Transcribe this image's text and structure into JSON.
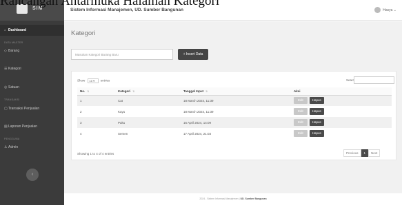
{
  "caption": "Rancangan Antarmuka Halaman Kategori",
  "sidebar": {
    "logo_text": "SIM",
    "items": [
      {
        "label": "Dashboard",
        "icon": "home-icon"
      },
      {
        "label": "Barang",
        "icon": "tag-icon"
      },
      {
        "label": "Kategori",
        "icon": "list-icon"
      },
      {
        "label": "Satuan",
        "icon": "scale-icon"
      },
      {
        "label": "Transaksi Penjualan",
        "icon": "cart-icon"
      },
      {
        "label": "Laporan Penjualan",
        "icon": "report-icon"
      },
      {
        "label": "Admin",
        "icon": "user-icon"
      }
    ],
    "headings": [
      "DATA MASTER",
      "TRANSAKSI",
      "PENGGUNA"
    ],
    "toggle": "‹"
  },
  "topbar": {
    "title": "Sistem Informasi Manajemen, UD. Sumber Bangunan",
    "user": "Hasya"
  },
  "page": {
    "title": "Kategori",
    "input_placeholder": "Masukan Kategori Barang Baru",
    "insert_label": "+ Insert Data"
  },
  "table": {
    "show_label": "Show",
    "entries_value": "10",
    "entries_label": "entries",
    "search_label": "Search:",
    "headers": [
      "No.",
      "Kategori",
      "Tanggal Input",
      "Aksi"
    ],
    "rows": [
      {
        "no": "1",
        "kategori": "Cat",
        "tanggal": "18 March 2024, 11:39"
      },
      {
        "no": "2",
        "kategori": "Kayu",
        "tanggal": "18 March 2024, 11:39"
      },
      {
        "no": "3",
        "kategori": "Paku",
        "tanggal": "16 April 2024, 14:09"
      },
      {
        "no": "4",
        "kategori": "Semen",
        "tanggal": "17 April 2024, 21:03"
      }
    ],
    "edit_label": "Edit",
    "delete_label": "Hapus",
    "showing": "Showing 1 to 4 of 4 entries",
    "pager": {
      "previous": "Previous",
      "current": "1",
      "next": "Next"
    }
  },
  "footer": {
    "text": "2024 - Sistem Informasi Manajemen",
    "brand": "UD. Sumber Bangunan"
  }
}
